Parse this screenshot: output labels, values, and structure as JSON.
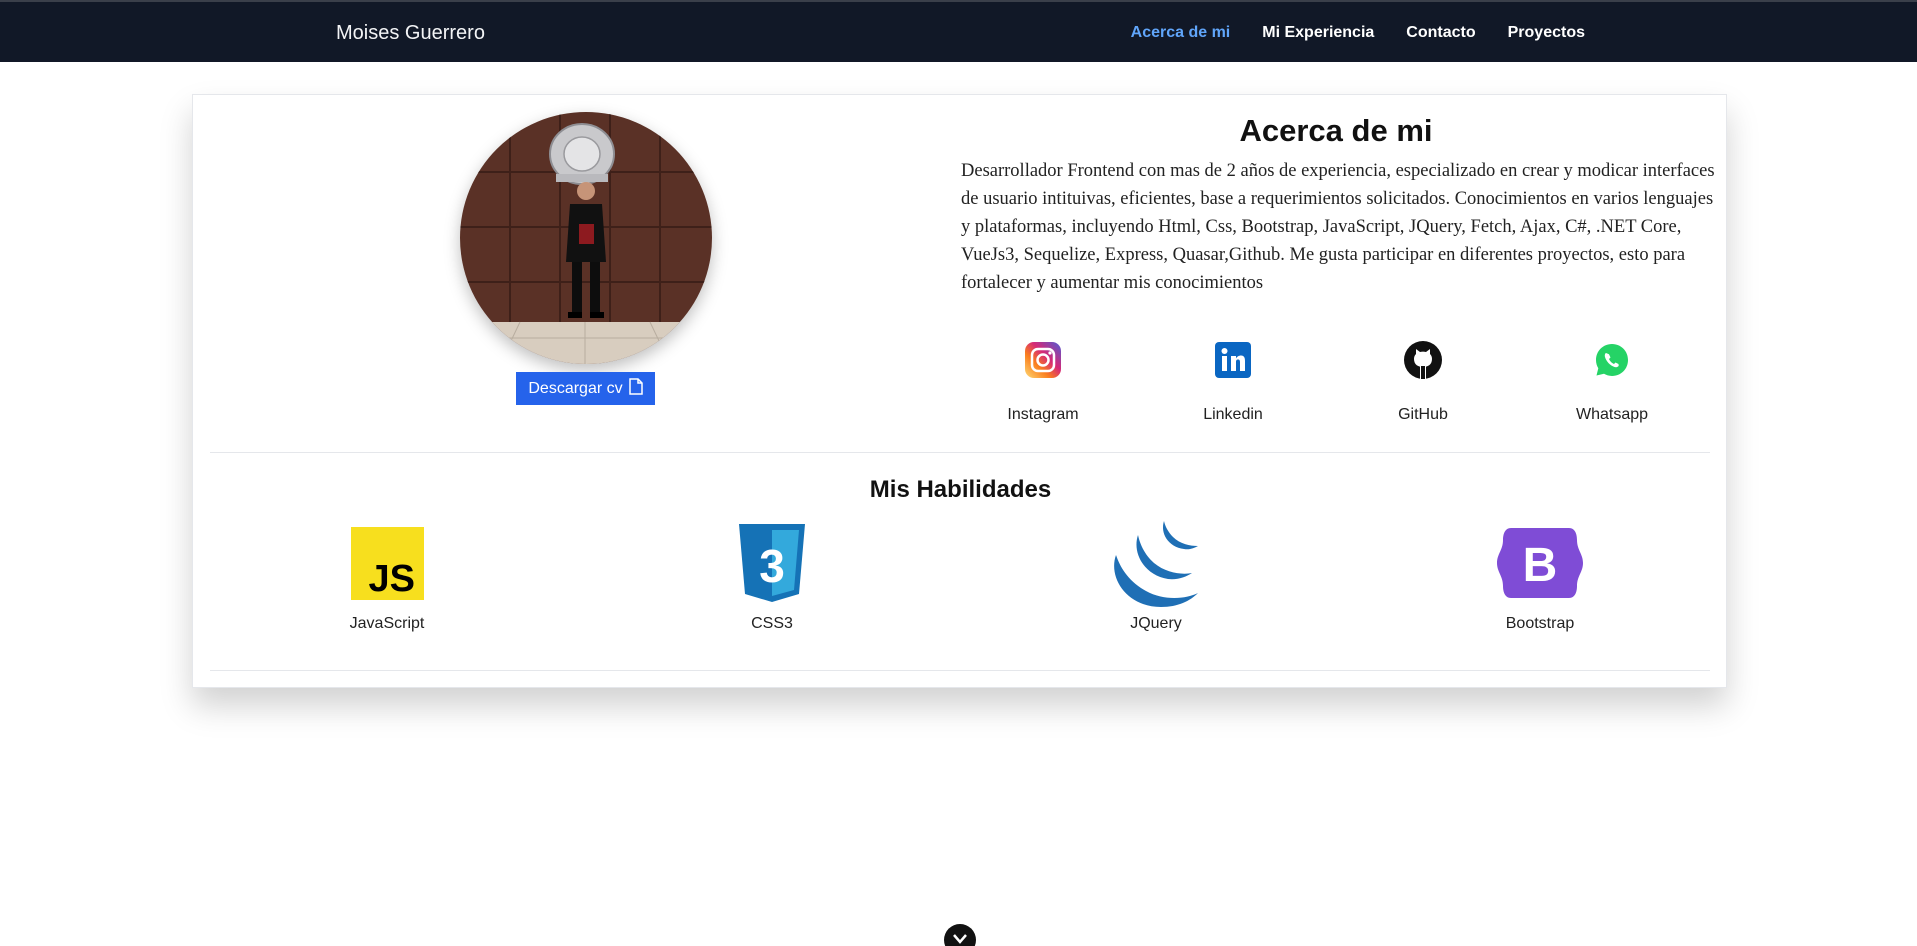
{
  "navbar": {
    "brand": "Moises Guerrero",
    "links": [
      {
        "label": "Acerca de mi",
        "active": true
      },
      {
        "label": "Mi Experiencia",
        "active": false
      },
      {
        "label": "Contacto",
        "active": false
      },
      {
        "label": "Proyectos",
        "active": false
      }
    ]
  },
  "about": {
    "title": "Acerca de mi",
    "description": "Desarrollador Frontend con mas de 2 años de experiencia, especializado en crear y modicar interfaces de usuario intituivas, eficientes, base a requerimientos solicitados. Conocimientos en varios lenguajes y plataformas, incluyendo Html, Css, Bootstrap, JavaScript, JQuery, Fetch, Ajax, C#, .NET Core, VueJs3, Sequelize, Express, Quasar,Github. Me gusta participar en diferentes proyectos, esto para fortalecer y aumentar mis conocimientos",
    "cv_button": "Descargar cv",
    "socials": [
      {
        "label": "Instagram",
        "icon": "instagram-icon"
      },
      {
        "label": "Linkedin",
        "icon": "linkedin-icon"
      },
      {
        "label": "GitHub",
        "icon": "github-icon"
      },
      {
        "label": "Whatsapp",
        "icon": "whatsapp-icon"
      }
    ]
  },
  "skills": {
    "title": "Mis Habilidades",
    "items": [
      {
        "label": "JavaScript",
        "icon": "javascript-logo"
      },
      {
        "label": "CSS3",
        "icon": "css3-logo"
      },
      {
        "label": "JQuery",
        "icon": "jquery-logo"
      },
      {
        "label": "Bootstrap",
        "icon": "bootstrap-logo"
      }
    ],
    "js_logo_text": "JS",
    "css_logo_text": "3",
    "bootstrap_logo_text": "B"
  },
  "colors": {
    "navbar_bg": "#111827",
    "active_link": "#60a5fa",
    "primary_button": "#2563eb"
  }
}
